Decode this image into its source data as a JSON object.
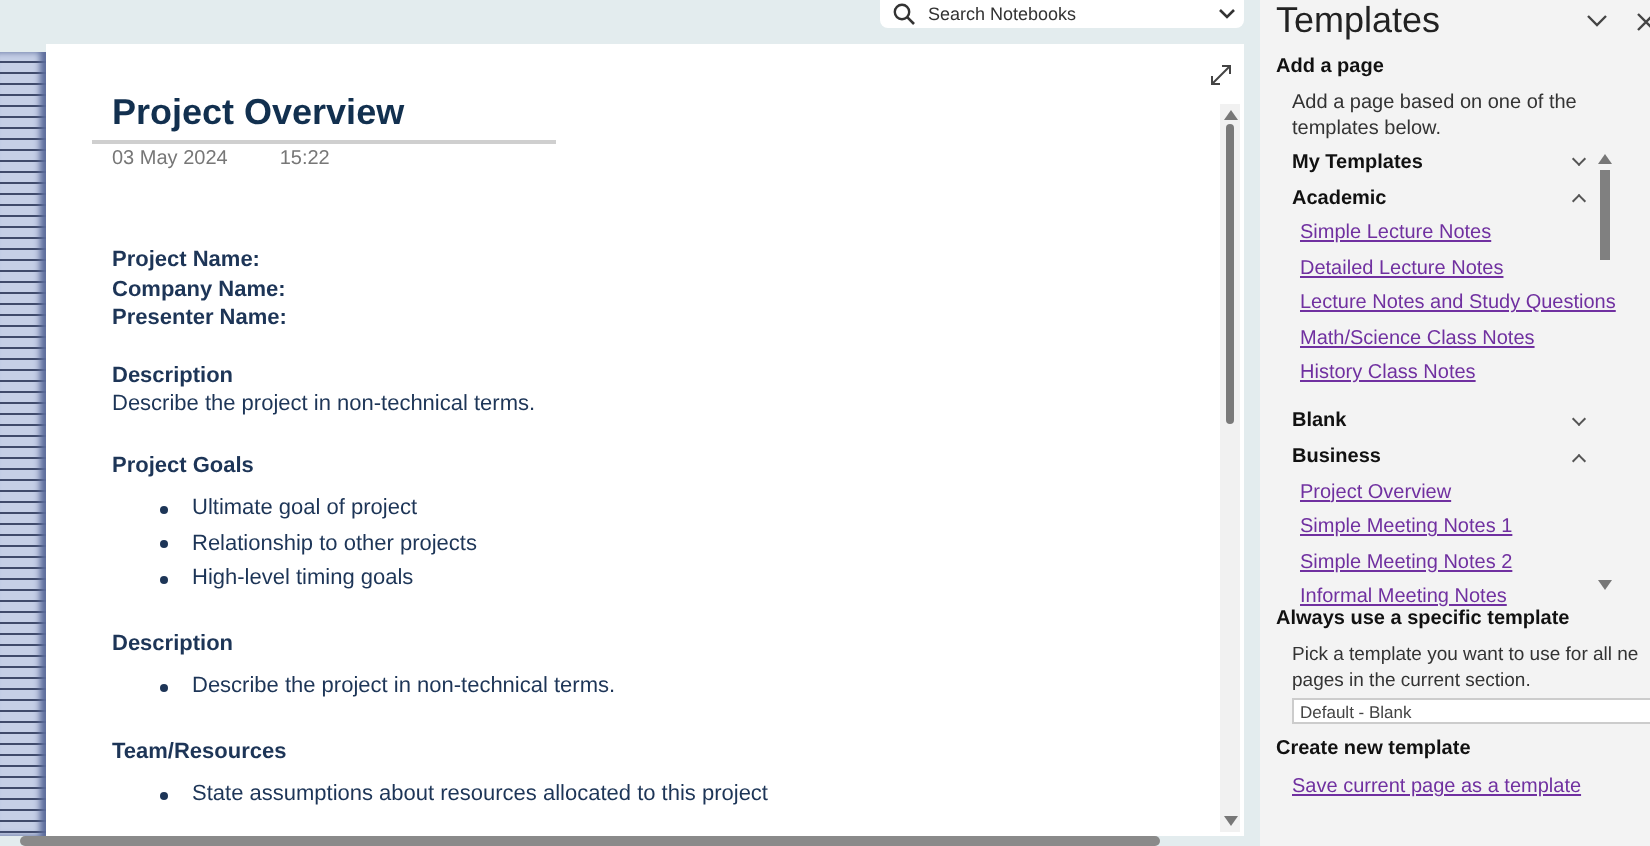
{
  "search": {
    "placeholder": "Search Notebooks"
  },
  "page": {
    "title": "Project Overview",
    "date": "03 May 2024",
    "time": "15:22",
    "fields": [
      "Project Name:",
      "Company Name:",
      "Presenter Name:"
    ],
    "sections": [
      {
        "kind": "paragraph",
        "heading": "Description",
        "text": "Describe the project in non-technical terms."
      },
      {
        "kind": "bullets",
        "heading": "Project Goals",
        "items": [
          "Ultimate goal of project",
          "Relationship to other projects",
          "High-level timing goals"
        ]
      },
      {
        "kind": "bullets",
        "heading": "Description",
        "items": [
          "Describe the project in non-technical terms."
        ]
      },
      {
        "kind": "bullets",
        "heading": "Team/Resources",
        "items": [
          "State assumptions about resources allocated to this project"
        ]
      }
    ]
  },
  "templates_pane": {
    "title": "Templates",
    "add_heading": "Add a page",
    "add_text": "Add a page based on one of the templates below.",
    "groups": [
      {
        "label": "My Templates",
        "expanded": false
      },
      {
        "label": "Academic",
        "expanded": true,
        "items": [
          "Simple Lecture Notes",
          "Detailed Lecture Notes",
          "Lecture Notes and Study Questions",
          "Math/Science Class Notes",
          "History Class Notes"
        ]
      },
      {
        "label": "Blank",
        "expanded": false
      },
      {
        "label": "Business",
        "expanded": true,
        "items": [
          "Project Overview",
          "Simple Meeting Notes 1",
          "Simple Meeting Notes 2",
          "Informal Meeting Notes"
        ]
      }
    ],
    "always_heading": "Always use a specific template",
    "always_lines": [
      "Pick a template you want to use for all ne",
      "pages in the current section."
    ],
    "default_select": "Default - Blank",
    "create_heading": "Create new template",
    "save_link": "Save current page as a template"
  }
}
